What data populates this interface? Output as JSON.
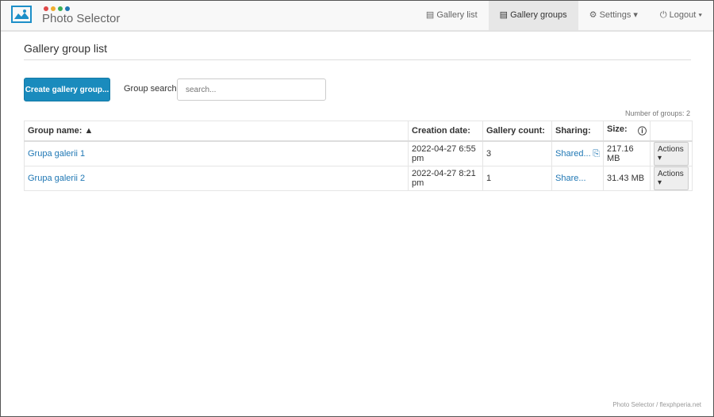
{
  "brand": {
    "title": "Photo Selector",
    "dot_colors": [
      "#e04848",
      "#f0ad2e",
      "#3aae55",
      "#1f77b4"
    ]
  },
  "nav": {
    "gallery_list": "Gallery list",
    "gallery_groups": "Gallery groups",
    "settings": "Settings ▾",
    "logout": "Logout ▾"
  },
  "page": {
    "title": "Gallery group list",
    "create_button": "Create gallery group...",
    "search_label": "Group search:",
    "search_placeholder": "search...",
    "count": "Number of groups: 2"
  },
  "table": {
    "headers": [
      "Group name: ▲",
      "Creation date:",
      "Gallery count:",
      "Sharing:",
      "Size:"
    ],
    "rows": [
      {
        "name": "Grupa galerii 1",
        "date": "2022-04-27 6:55 pm",
        "count": "3",
        "sharing": "Shared...",
        "size": "217.16 MB",
        "actions": "Actions ▾"
      },
      {
        "name": "Grupa galerii 2",
        "date": "2022-04-27 8:21 pm",
        "count": "1",
        "sharing": "Share...",
        "size": "31.43 MB",
        "actions": "Actions ▾"
      }
    ]
  },
  "footer": "Photo Selector / flexphperia.net"
}
